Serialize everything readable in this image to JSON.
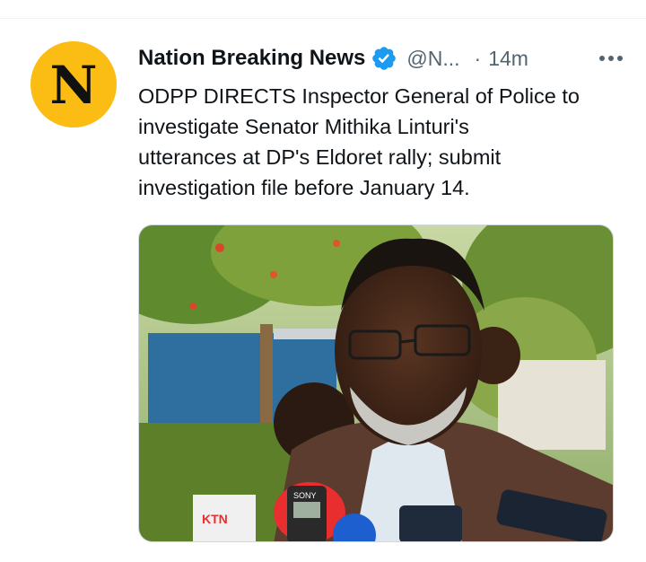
{
  "tweet": {
    "author_name": "Nation Breaking News",
    "avatar_letter": "N",
    "handle": "@N...",
    "separator": "·",
    "timestamp": "14m",
    "text_lines": [
      "ODPP DIRECTS Inspector General of Police to",
      "investigate Senator Mithika Linturi's",
      "utterances at DP's Eldoret rally; submit",
      "investigation file before January 14."
    ],
    "media": {
      "mic_labels": [
        "SONY",
        "KTN"
      ]
    }
  },
  "colors": {
    "avatar_background": "#fbbc13",
    "verified_badge": "#1d9bf0",
    "secondary_text": "#536471",
    "primary_text": "#0f1419"
  },
  "icons": {
    "verified": "verified-badge-icon",
    "more": "more-options-icon"
  }
}
